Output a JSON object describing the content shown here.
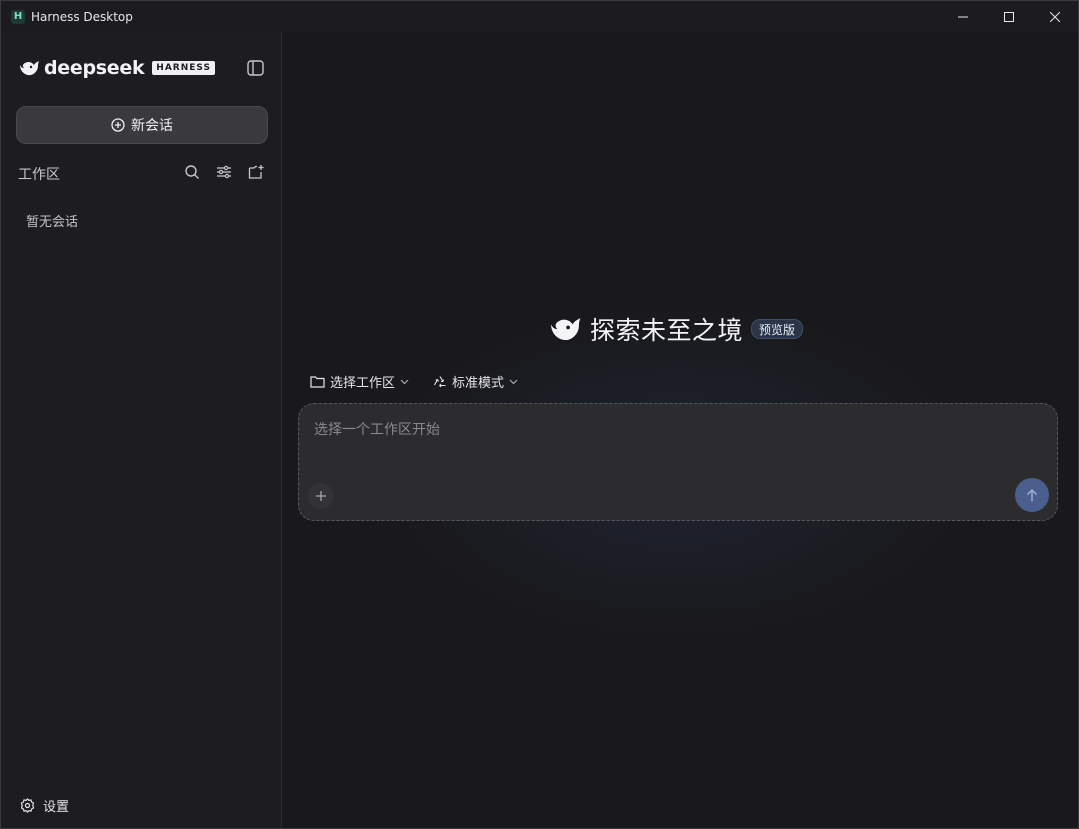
{
  "window": {
    "title": "Harness Desktop",
    "app_icon_letter": "H"
  },
  "sidebar": {
    "brand_name": "deepseek",
    "brand_badge": "HARNESS",
    "new_chat_label": "新会话",
    "workspace_label": "工作区",
    "empty_label": "暂无会话",
    "settings_label": "设置"
  },
  "main": {
    "hero_title": "探索未至之境",
    "preview_badge": "预览版",
    "workspace_select_label": "选择工作区",
    "mode_select_label": "标准模式",
    "composer_placeholder": "选择一个工作区开始"
  },
  "colors": {
    "accent_send": "#4a5f8e",
    "background": "#19191b",
    "sidebar": "#1d1d1f"
  },
  "icons": [
    "minimize-icon",
    "maximize-icon",
    "close-icon",
    "whale-logo-icon",
    "sidebar-toggle-icon",
    "plus-circle-icon",
    "search-icon",
    "filter-icon",
    "new-folder-icon",
    "gear-icon",
    "folder-icon",
    "recycle-icon",
    "chevron-down-icon",
    "plus-icon",
    "arrow-up-icon"
  ]
}
